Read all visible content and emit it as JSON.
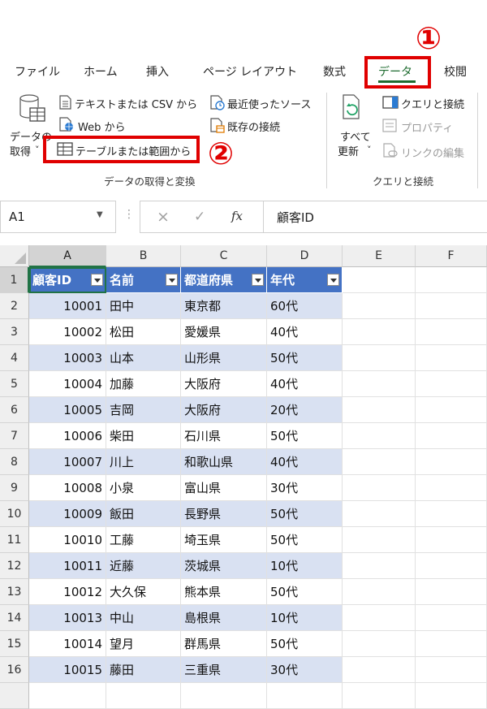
{
  "annotations": {
    "step1": "①",
    "step2": "②"
  },
  "ribbon": {
    "tabs": [
      {
        "label": "ファイル",
        "active": false
      },
      {
        "label": "ホーム",
        "active": false
      },
      {
        "label": "挿入",
        "active": false
      },
      {
        "label": "ページ レイアウト",
        "active": false
      },
      {
        "label": "数式",
        "active": false
      },
      {
        "label": "データ",
        "active": true
      },
      {
        "label": "校閲",
        "active": false
      }
    ],
    "get_data": {
      "label_line1": "データの",
      "label_line2": "取得",
      "caret": "˅"
    },
    "from_text_csv": "テキストまたは CSV から",
    "from_web": "Web から",
    "from_table": "テーブルまたは範囲から",
    "recent_sources": "最近使ったソース",
    "existing_connections": "既存の接続",
    "group_get_transform": "データの取得と変換",
    "refresh_all": {
      "label_line1": "すべて",
      "label_line2": "更新",
      "caret": "˅"
    },
    "queries_connections": "クエリと接続",
    "properties": "プロパティ",
    "edit_links": "リンクの編集",
    "group_queries": "クエリと接続"
  },
  "formula_bar": {
    "name_box": "A1",
    "fx": "fx",
    "cancel": "×",
    "enter": "✓",
    "content": "顧客ID"
  },
  "sheet": {
    "columns": [
      "A",
      "B",
      "C",
      "D",
      "E",
      "F"
    ],
    "selected_cell": "A1",
    "headers": [
      "顧客ID",
      "名前",
      "都道府県",
      "年代"
    ],
    "rows": [
      [
        "1",
        "",
        "",
        "",
        ""
      ],
      [
        "2",
        "10001",
        "田中",
        "東京都",
        "60代"
      ],
      [
        "3",
        "10002",
        "松田",
        "愛媛県",
        "40代"
      ],
      [
        "4",
        "10003",
        "山本",
        "山形県",
        "50代"
      ],
      [
        "5",
        "10004",
        "加藤",
        "大阪府",
        "40代"
      ],
      [
        "6",
        "10005",
        "吉岡",
        "大阪府",
        "20代"
      ],
      [
        "7",
        "10006",
        "柴田",
        "石川県",
        "50代"
      ],
      [
        "8",
        "10007",
        "川上",
        "和歌山県",
        "40代"
      ],
      [
        "9",
        "10008",
        "小泉",
        "富山県",
        "30代"
      ],
      [
        "10",
        "10009",
        "飯田",
        "長野県",
        "50代"
      ],
      [
        "11",
        "10010",
        "工藤",
        "埼玉県",
        "50代"
      ],
      [
        "12",
        "10011",
        "近藤",
        "茨城県",
        "10代"
      ],
      [
        "13",
        "10012",
        "大久保",
        "熊本県",
        "50代"
      ],
      [
        "14",
        "10013",
        "中山",
        "島根県",
        "10代"
      ],
      [
        "15",
        "10014",
        "望月",
        "群馬県",
        "50代"
      ],
      [
        "16",
        "10015",
        "藤田",
        "三重県",
        "30代"
      ]
    ]
  },
  "colors": {
    "accent": "#217346",
    "table_header": "#4472c4",
    "table_band": "#d9e1f2",
    "annotation": "#e00000"
  }
}
